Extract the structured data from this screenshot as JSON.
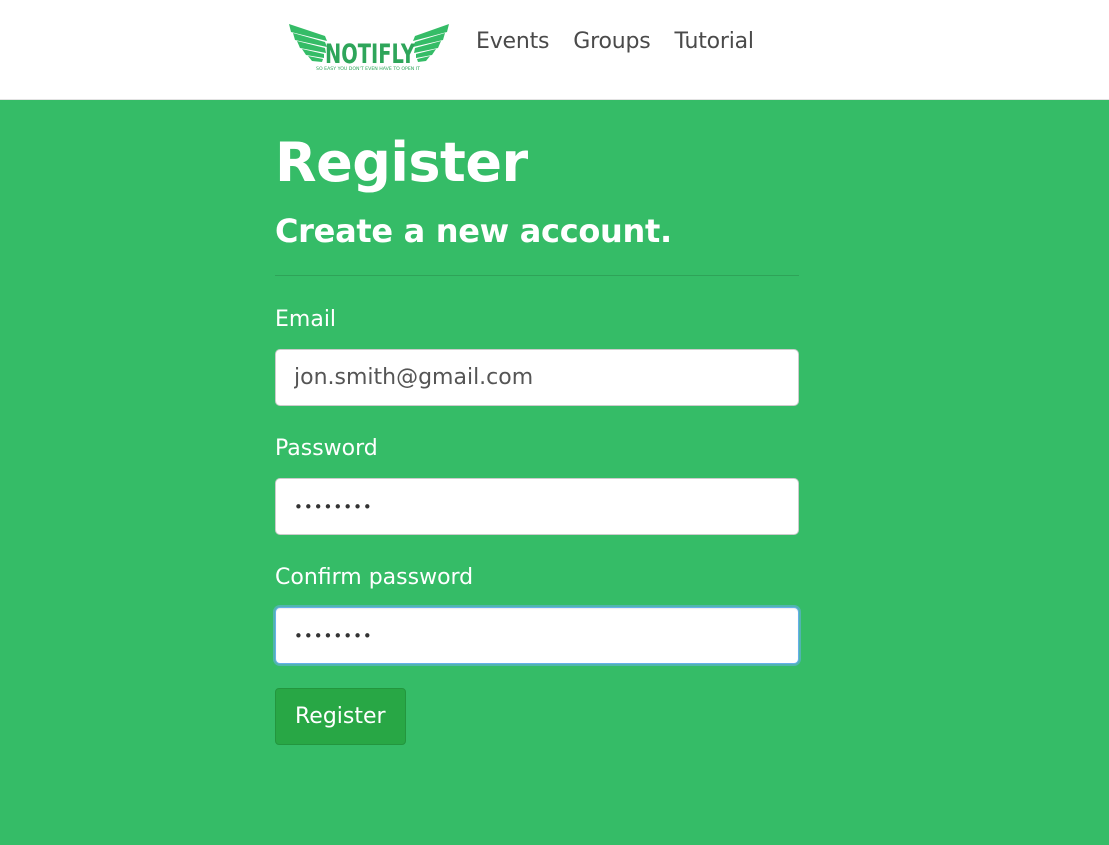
{
  "navbar": {
    "brand_name": "NOTIFLY",
    "brand_tagline": "SO EASY YOU DON'T EVEN HAVE TO OPEN IT",
    "brand_color": "#35bc67",
    "links": [
      {
        "label": "Events"
      },
      {
        "label": "Groups"
      },
      {
        "label": "Tutorial"
      }
    ]
  },
  "page": {
    "title": "Register",
    "subtitle": "Create a new account.",
    "background_color": "#35bc67"
  },
  "form": {
    "email_label": "Email",
    "email_value": "jon.smith@gmail.com",
    "password_label": "Password",
    "password_value": "••••••••",
    "confirm_label": "Confirm password",
    "confirm_value": "••••••••",
    "submit_label": "Register",
    "button_color": "#28a745"
  }
}
